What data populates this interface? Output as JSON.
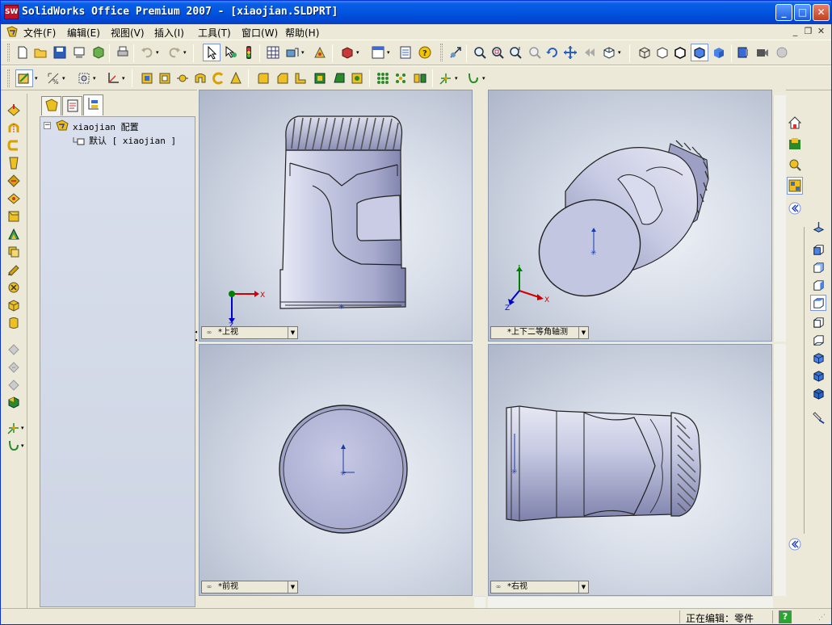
{
  "window": {
    "app_icon_text": "SW",
    "title": "SolidWorks Office Premium 2007 - [xiaojian.SLDPRT]",
    "min_glyph": "_",
    "max_glyph": "□",
    "close_glyph": "✕"
  },
  "menubar": {
    "items": [
      "文件(F)",
      "编辑(E)",
      "视图(V)",
      "插入(I)",
      "工具(T)",
      "窗口(W)",
      "帮助(H)"
    ],
    "mdi_min": "_",
    "mdi_restore": "❐",
    "mdi_close": "✕"
  },
  "featuremanager": {
    "tree_root": "xiaojian 配置",
    "tree_config": "默认 [ xiaojian ]",
    "expand_glyph": "−"
  },
  "viewports": {
    "top": "*上视",
    "iso": "*上下二等角轴测",
    "front": "*前视",
    "right": "*右视"
  },
  "axes": {
    "x": "X",
    "y": "Y",
    "z": "Z"
  },
  "status": {
    "text": "正在编辑：零件",
    "help": "?"
  },
  "colors": {
    "titlebar": "#0048d6",
    "viewport_bg": "#d6dce7",
    "part_body": "#c4c7e0",
    "axis_x": "#d00000",
    "axis_y": "#008000",
    "axis_z": "#0000d0"
  }
}
